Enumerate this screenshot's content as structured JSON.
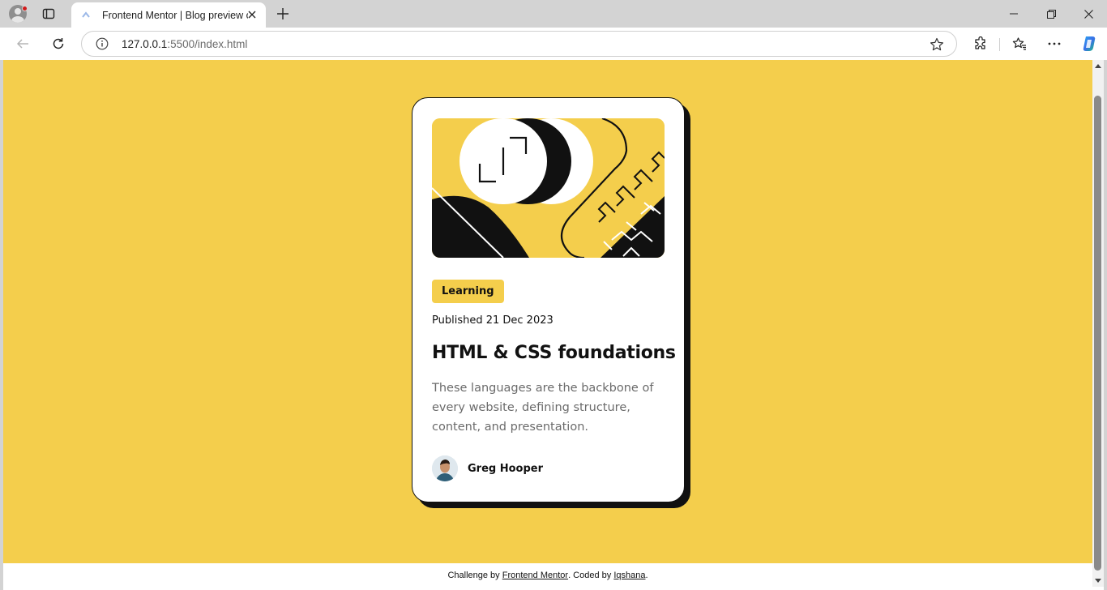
{
  "browser": {
    "tab_title": "Frontend Mentor | Blog preview c",
    "url_host": "127.0.0.1",
    "url_rest": ":5500/index.html",
    "icons": [
      "profile-icon",
      "tabs-icon",
      "close-icon",
      "new-tab-icon",
      "back-icon",
      "reload-icon",
      "info-icon",
      "star-icon",
      "extensions-icon",
      "favorites-icon",
      "more-icon",
      "copilot-icon",
      "minimize-icon",
      "maximize-icon",
      "window-close-icon"
    ]
  },
  "colors": {
    "page_background": "#f4ce4c",
    "card_background": "#ffffff",
    "ink": "#111111",
    "muted_text": "#6b6b6b"
  },
  "card": {
    "tag": "Learning",
    "published": "Published 21 Dec 2023",
    "title": "HTML & CSS foundations",
    "description": "These languages are the backbone of every website, defining structure, content, and presentation.",
    "author": "Greg Hooper"
  },
  "footer": {
    "prefix": "Challenge by ",
    "link1": "Frontend Mentor",
    "middle": ". Coded by ",
    "link2": "Iqshana",
    "suffix": "."
  }
}
